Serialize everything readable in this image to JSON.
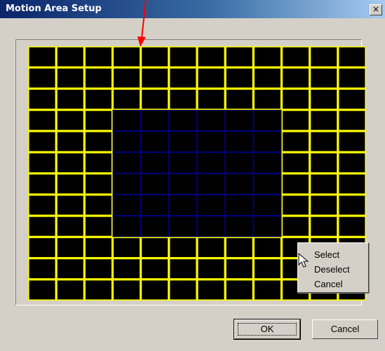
{
  "window": {
    "title": "Motion Area Setup",
    "close_glyph": "×"
  },
  "grid": {
    "columns": 12,
    "rows": 12,
    "cell_color": "#000000",
    "line_color": "#ffff00",
    "selected_line_color": "#000080",
    "selected_region": {
      "col_start": 3,
      "col_end": 9,
      "row_start": 3,
      "row_end": 9
    }
  },
  "context_menu": {
    "items": [
      "Select",
      "Deselect",
      "Cancel"
    ]
  },
  "buttons": {
    "ok": "OK",
    "cancel": "Cancel"
  },
  "annotation": {
    "arrow_color": "#ff0000"
  },
  "icons": {
    "cursor": "mouse-pointer-icon",
    "close": "close-icon",
    "arrow": "red-arrow-icon"
  }
}
